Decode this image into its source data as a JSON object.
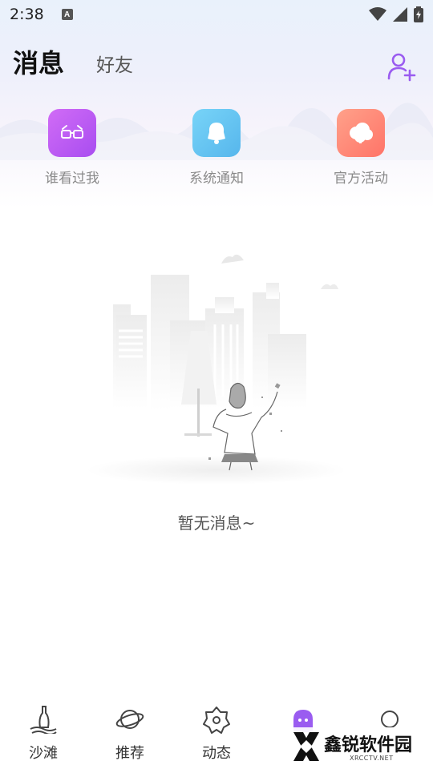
{
  "status_bar": {
    "time": "2:38",
    "notification_icon": "a-icon"
  },
  "header": {
    "tabs": [
      {
        "label": "消息",
        "active": true
      },
      {
        "label": "好友",
        "active": false
      }
    ],
    "add_friend_icon": "add-user-icon",
    "accent_color": "#9a5cf0"
  },
  "quick_entries": [
    {
      "label": "谁看过我",
      "icon": "glasses-icon",
      "color": "#c45bf2"
    },
    {
      "label": "系统通知",
      "icon": "bell-icon",
      "color": "#5ec4f0"
    },
    {
      "label": "官方活动",
      "icon": "cloud-icon",
      "color": "#ff8a78"
    }
  ],
  "empty_state": {
    "text": "暂无消息~"
  },
  "bottom_nav": [
    {
      "label": "沙滩",
      "icon": "beach-icon"
    },
    {
      "label": "推荐",
      "icon": "planet-icon"
    },
    {
      "label": "动态",
      "icon": "flower-icon"
    },
    {
      "label": "",
      "icon": "ghost-icon",
      "active": true
    },
    {
      "label": "",
      "icon": "circle-icon"
    }
  ],
  "watermark": {
    "title": "鑫锐软件园",
    "subtitle": "XRCCTV.NET"
  }
}
